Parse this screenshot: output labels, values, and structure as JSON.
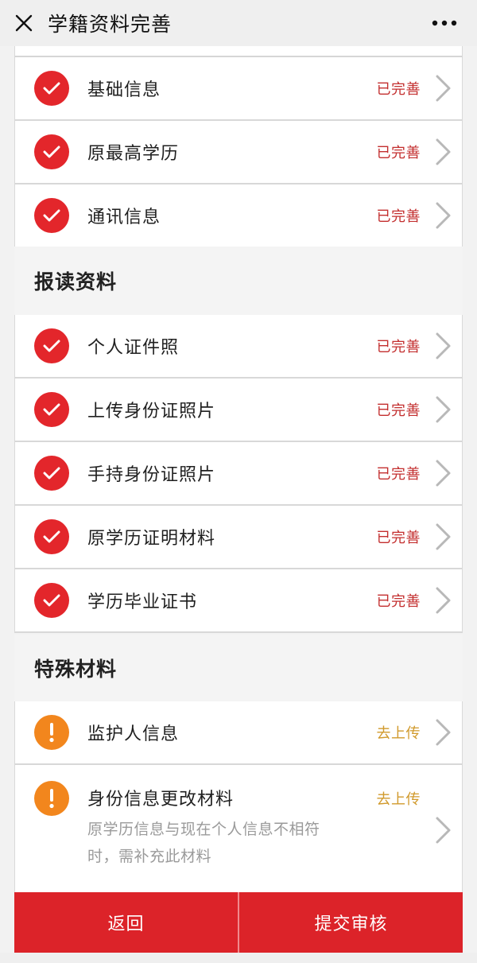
{
  "header": {
    "title": "学籍资料完善",
    "close_icon": "close-icon",
    "more_icon": "more-dots-icon"
  },
  "group1": {
    "items": [
      {
        "label": "基础信息",
        "status": "已完善",
        "state": "done"
      },
      {
        "label": "原最高学历",
        "status": "已完善",
        "state": "done"
      },
      {
        "label": "通讯信息",
        "status": "已完善",
        "state": "done"
      }
    ]
  },
  "section2": {
    "title": "报读资料",
    "items": [
      {
        "label": "个人证件照",
        "status": "已完善",
        "state": "done"
      },
      {
        "label": "上传身份证照片",
        "status": "已完善",
        "state": "done"
      },
      {
        "label": "手持身份证照片",
        "status": "已完善",
        "state": "done"
      },
      {
        "label": "原学历证明材料",
        "status": "已完善",
        "state": "done"
      },
      {
        "label": "学历毕业证书",
        "status": "已完善",
        "state": "done"
      }
    ]
  },
  "section3": {
    "title": "特殊材料",
    "items": [
      {
        "label": "监护人信息",
        "status": "去上传",
        "state": "todo"
      },
      {
        "label": "身份信息更改材料",
        "status": "去上传",
        "state": "todo",
        "description": "原学历信息与现在个人信息不相符时，需补充此材料"
      }
    ]
  },
  "footer": {
    "back_label": "返回",
    "submit_label": "提交审核"
  },
  "colors": {
    "accent_red": "#e3262b",
    "warning_orange": "#f2861d",
    "status_done": "#c32e2e",
    "status_todo": "#d19a2c"
  }
}
